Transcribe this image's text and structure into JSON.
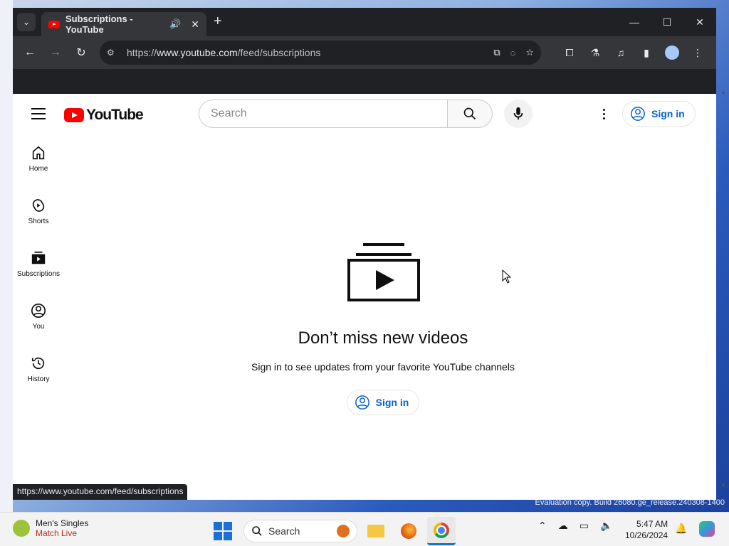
{
  "browser": {
    "tab_title": "Subscriptions - YouTube",
    "url_prefix": "https://",
    "url_domain": "www.youtube.com",
    "url_path": "/feed/subscriptions",
    "status_url": "https://www.youtube.com/feed/subscriptions"
  },
  "youtube": {
    "logo_text": "YouTube",
    "search_placeholder": "Search",
    "signin_label": "Sign in",
    "guide": [
      {
        "label": "Home",
        "icon": "home-icon"
      },
      {
        "label": "Shorts",
        "icon": "shorts-icon"
      },
      {
        "label": "Subscriptions",
        "icon": "subscriptions-icon"
      },
      {
        "label": "You",
        "icon": "you-icon"
      },
      {
        "label": "History",
        "icon": "history-icon"
      }
    ],
    "empty_title": "Don’t miss new videos",
    "empty_subtitle": "Sign in to see updates from your favorite YouTube channels"
  },
  "taskbar": {
    "widget_title": "Men's Singles",
    "widget_subtitle": "Match Live",
    "search_label": "Search",
    "time": "5:47 AM",
    "date": "10/26/2024"
  },
  "desktop": {
    "watermark": "Evaluation copy. Build 26080.ge_release.240308-1400"
  },
  "colors": {
    "youtube_red": "#ff0000",
    "link_blue": "#065fd4",
    "chrome_dark": "#202124"
  }
}
